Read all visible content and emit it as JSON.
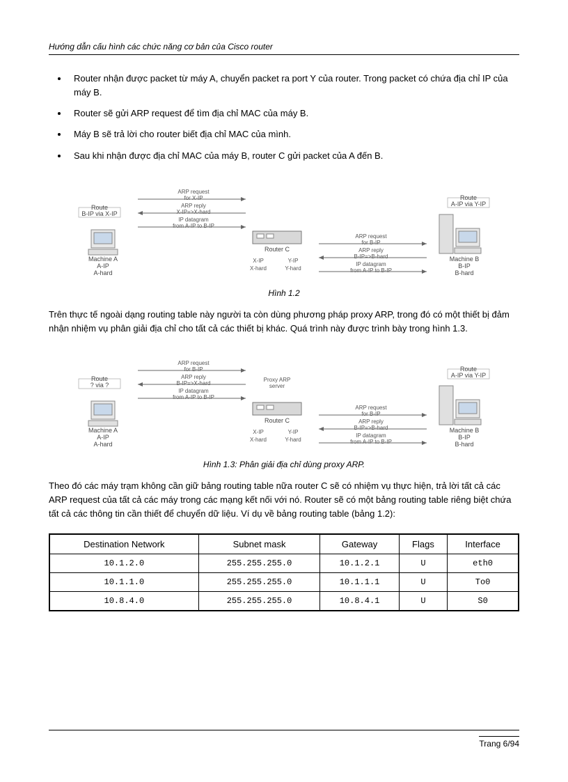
{
  "header": "Hướng dẫn cấu hình các chức năng cơ bản của Cisco router",
  "bullets": [
    "Router nhận được packet từ máy A, chuyển packet ra port Y của router. Trong packet có chứa địa chỉ IP của máy B.",
    "Router sẽ gửi ARP request để tìm địa chỉ MAC của máy B.",
    "Máy B sẽ trả lời cho router biết địa chỉ MAC của mình.",
    "Sau khi nhận được địa chỉ MAC của  máy B, router C gửi packet của A đến B."
  ],
  "fig1": {
    "caption": "Hình 1.2",
    "left": {
      "route": "Route\nB-IP via X-IP",
      "machine": "Machine A",
      "ip": "A-IP",
      "hard": "A-hard"
    },
    "center": {
      "arp_req": "ARP request\nfor X-IP",
      "arp_reply": "ARP reply\nX-IP=>X-hard",
      "ip_dg": "IP datagram\nfrom A-IP to B-IP",
      "router": "Router C",
      "xip": "X-IP",
      "yip": "Y-IP",
      "xhard": "X-hard",
      "yhard": "Y-hard"
    },
    "right_mid": {
      "arp_req": "ARP request\nfor B-IP",
      "arp_reply": "ARP reply\nB-IP=>B-hard",
      "ip_dg": "IP datagram\nfrom A-IP to B-IP"
    },
    "right": {
      "route": "Route\nA-IP via Y-IP",
      "machine": "Machine B",
      "ip": "B-IP",
      "hard": "B-hard"
    }
  },
  "para1": "Trên thực tế ngoài dạng routing table này người ta còn dùng phương pháp proxy ARP, trong đó có một thiết bị đảm nhận nhiệm vụ phân giải địa chỉ cho tất cả các thiết bị khác. Quá trình này được trình bày trong hình 1.3.",
  "fig2": {
    "caption": "Hình 1.3: Phân giải địa chỉ dùng proxy ARP.",
    "left": {
      "route": "Route\n? via ?",
      "machine": "Machine A",
      "ip": "A-IP",
      "hard": "A-hard"
    },
    "center": {
      "arp_req": "ARP request\nfor B-IP",
      "arp_reply": "ARP reply\nB-IP=>X-hard",
      "ip_dg": "IP datagram\nfrom A-IP to B-IP",
      "proxy": "Proxy ARP\nserver",
      "router": "Router C",
      "xip": "X-IP",
      "yip": "Y-IP",
      "xhard": "X-hard",
      "yhard": "Y-hard"
    },
    "right_mid": {
      "arp_req": "ARP request\nfor B-IP",
      "arp_reply": "ARP reply\nB-IP=>B-hard",
      "ip_dg": "IP datagram\nfrom A-IP to B-IP"
    },
    "right": {
      "route": "Route\nA-IP via Y-IP",
      "machine": "Machine B",
      "ip": "B-IP",
      "hard": "B-hard"
    }
  },
  "para2": "Theo đó các máy trạm không cần giữ bảng routing table nữa router C sẽ có nhiệm vụ thực hiện, trả lời tất cả các ARP request của tất cả các máy trong các mạng kết nối với nó. Router sẽ có một bảng routing table riêng biệt chứa tất cả các thông tin cần thiết để chuyển dữ liệu. Ví dụ về bảng routing table (bảng 1.2):",
  "table": {
    "headers": [
      "Destination Network",
      "Subnet mask",
      "Gateway",
      "Flags",
      "Interface"
    ],
    "rows": [
      [
        "10.1.2.0",
        "255.255.255.0",
        "10.1.2.1",
        "U",
        "eth0"
      ],
      [
        "10.1.1.0",
        "255.255.255.0",
        "10.1.1.1",
        "U",
        "To0"
      ],
      [
        "10.8.4.0",
        "255.255.255.0",
        "10.8.4.1",
        "U",
        "S0"
      ]
    ]
  },
  "footer": "Trang 6/94"
}
